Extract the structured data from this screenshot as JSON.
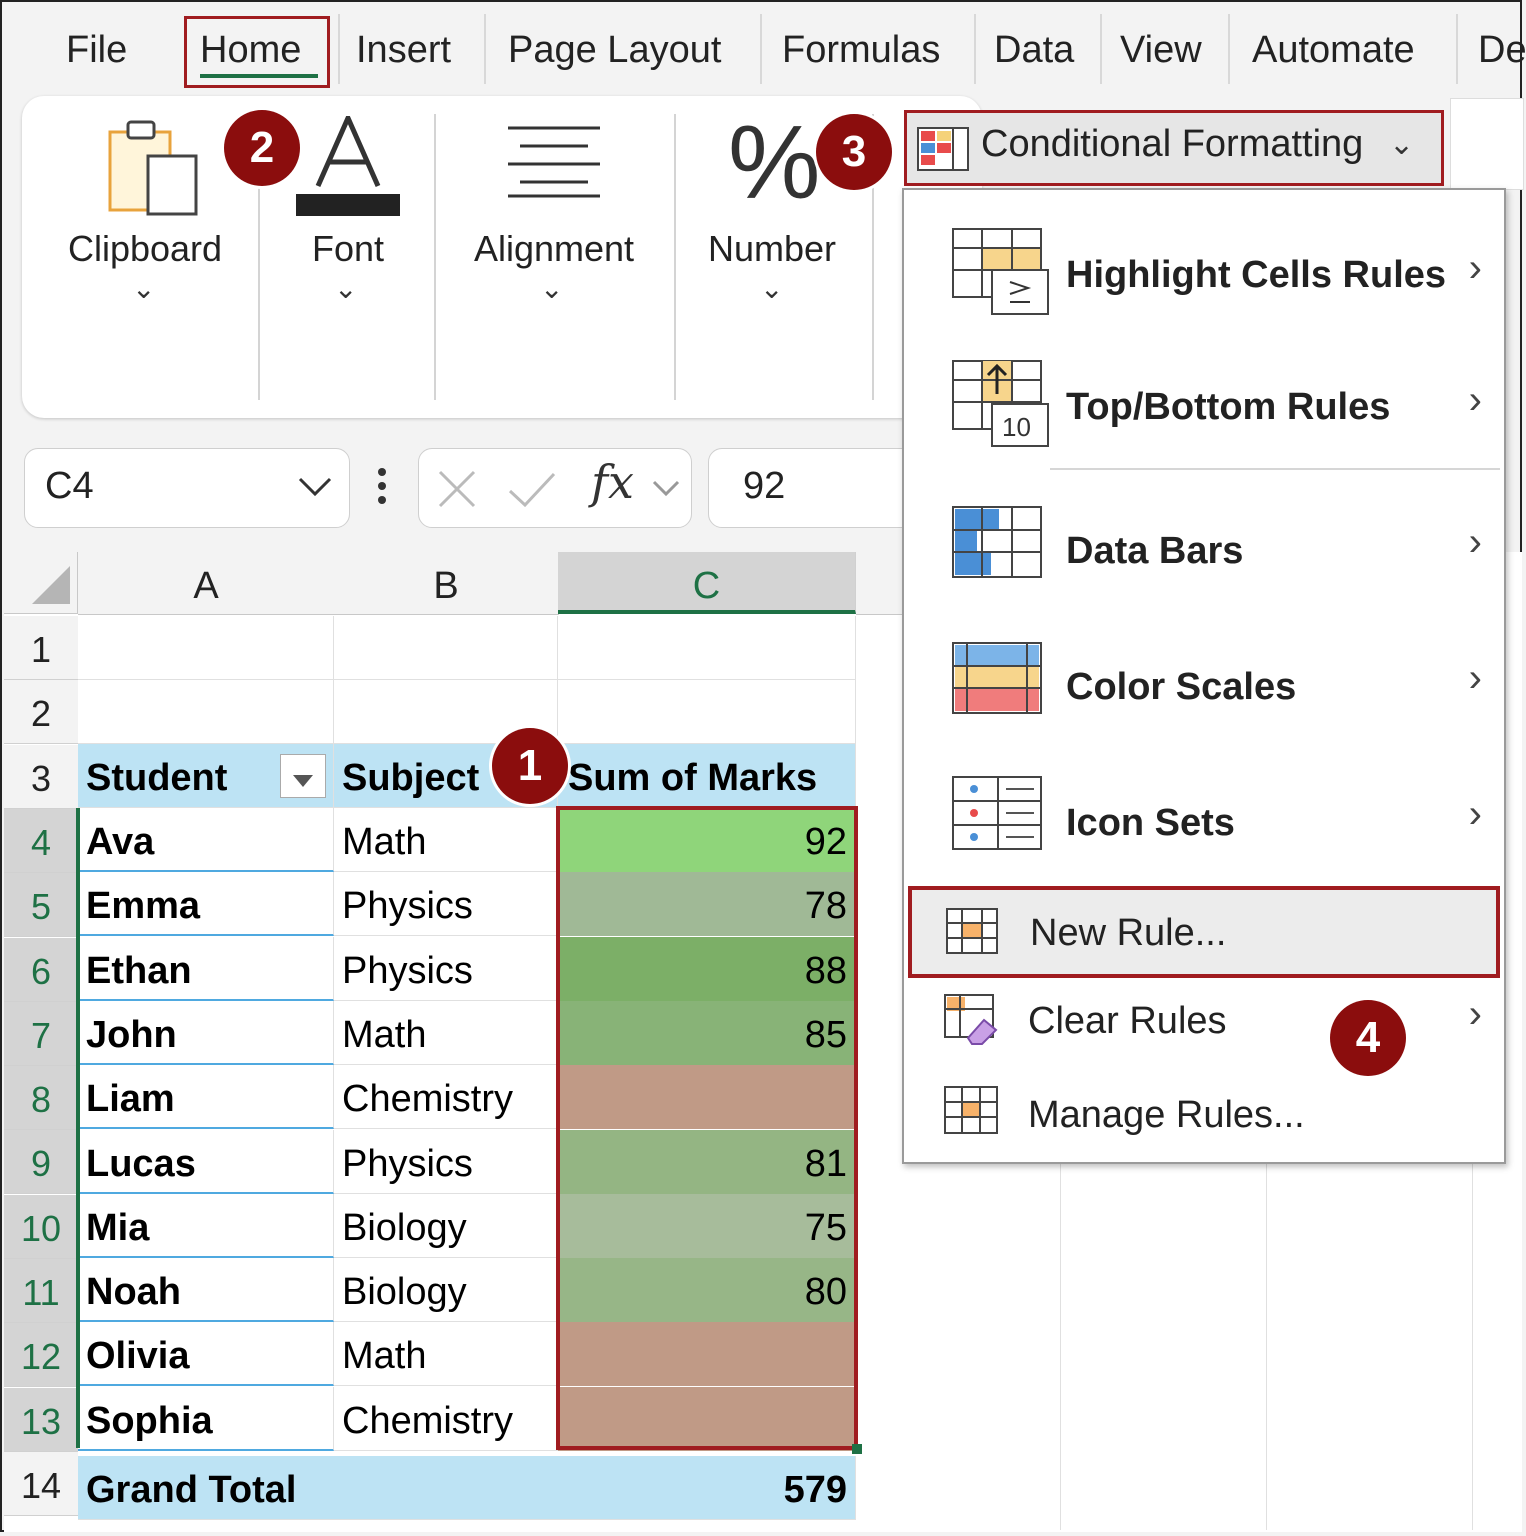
{
  "tabs": [
    "File",
    "Home",
    "Insert",
    "Page Layout",
    "Formulas",
    "Data",
    "View",
    "Automate",
    "De"
  ],
  "ribbon": {
    "groups": [
      "Clipboard",
      "Font",
      "Alignment",
      "Number"
    ],
    "chevron": "⌄",
    "cf_button": "Conditional Formatting",
    "cf_chevron": "⌄"
  },
  "badges": [
    "1",
    "2",
    "3",
    "4"
  ],
  "formula_bar": {
    "name_box": "C4",
    "fx": "fx",
    "value": "92"
  },
  "columns": [
    "A",
    "B",
    "C"
  ],
  "rows": [
    "1",
    "2",
    "3",
    "4",
    "5",
    "6",
    "7",
    "8",
    "9",
    "10",
    "11",
    "12",
    "13",
    "14"
  ],
  "table": {
    "headers": [
      "Student",
      "Subject",
      "Sum of Marks"
    ],
    "records": [
      {
        "student": "Ava",
        "subject": "Math",
        "marks": "92",
        "color": "#8fd57a"
      },
      {
        "student": "Emma",
        "subject": "Physics",
        "marks": "78",
        "color": "#a0b996"
      },
      {
        "student": "Ethan",
        "subject": "Physics",
        "marks": "88",
        "color": "#7caf67"
      },
      {
        "student": "John",
        "subject": "Math",
        "marks": "85",
        "color": "#88b377"
      },
      {
        "student": "Liam",
        "subject": "Chemistry",
        "marks": "",
        "color": "#c09a86"
      },
      {
        "student": "Lucas",
        "subject": "Physics",
        "marks": "81",
        "color": "#94b583"
      },
      {
        "student": "Mia",
        "subject": "Biology",
        "marks": "75",
        "color": "#a7bc9b"
      },
      {
        "student": "Noah",
        "subject": "Biology",
        "marks": "80",
        "color": "#97b687"
      },
      {
        "student": "Olivia",
        "subject": "Math",
        "marks": "",
        "color": "#c09a86"
      },
      {
        "student": "Sophia",
        "subject": "Chemistry",
        "marks": "",
        "color": "#c09a86"
      }
    ],
    "grand_total_label": "Grand Total",
    "grand_total_value": "579"
  },
  "menu": {
    "items": [
      {
        "label": "Highlight Cells Rules",
        "arrow": "›",
        "icon": "highlight-cells-rules-icon"
      },
      {
        "label": "Top/Bottom Rules",
        "arrow": "›",
        "icon": "top-bottom-rules-icon"
      },
      {
        "label": "Data Bars",
        "arrow": "›",
        "icon": "data-bars-icon"
      },
      {
        "label": "Color Scales",
        "arrow": "›",
        "icon": "color-scales-icon"
      },
      {
        "label": "Icon Sets",
        "arrow": "›",
        "icon": "icon-sets-icon"
      }
    ],
    "new_rule": "New Rule...",
    "clear_rules": "Clear Rules",
    "clear_arrow": "›",
    "manage_rules": "Manage Rules..."
  },
  "colors": {
    "accent_red": "#a01c20",
    "badge": "#8b0d0d",
    "excel_green": "#1e7145",
    "table_header": "#bde3f4"
  }
}
